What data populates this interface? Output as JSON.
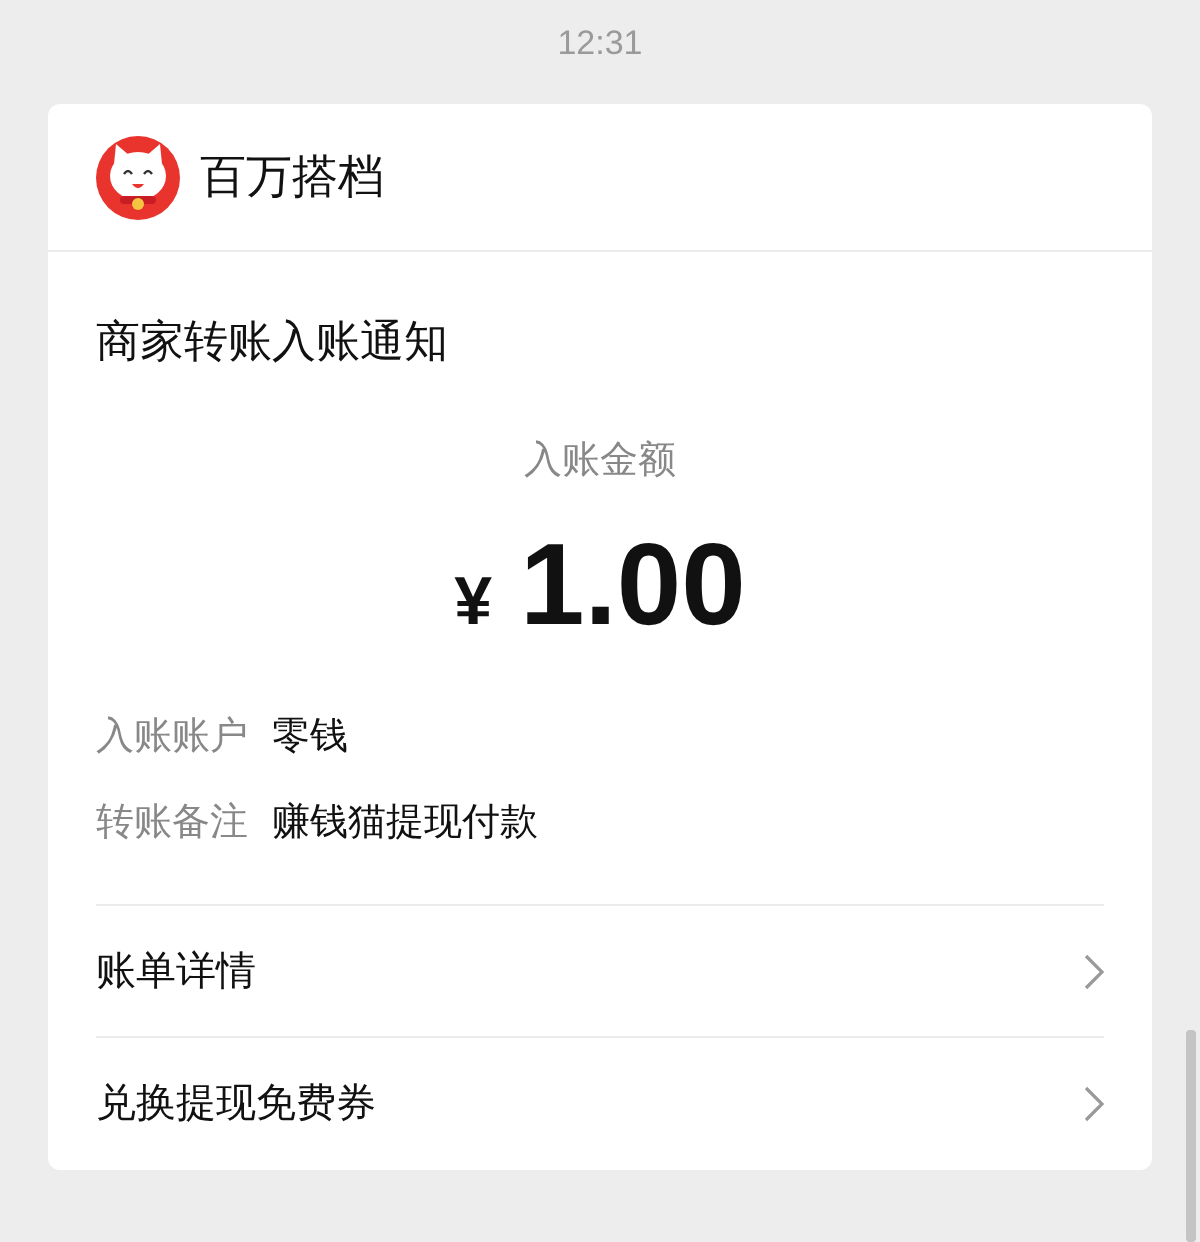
{
  "time": "12:31",
  "card": {
    "app_name": "百万搭档",
    "title": "商家转账入账通知",
    "amount_label": "入账金额",
    "currency": "¥",
    "amount": "1.00",
    "details": [
      {
        "label": "入账账户",
        "value": "零钱"
      },
      {
        "label": "转账备注",
        "value": "赚钱猫提现付款"
      }
    ],
    "links": [
      "账单详情",
      "兑换提现免费券"
    ]
  }
}
